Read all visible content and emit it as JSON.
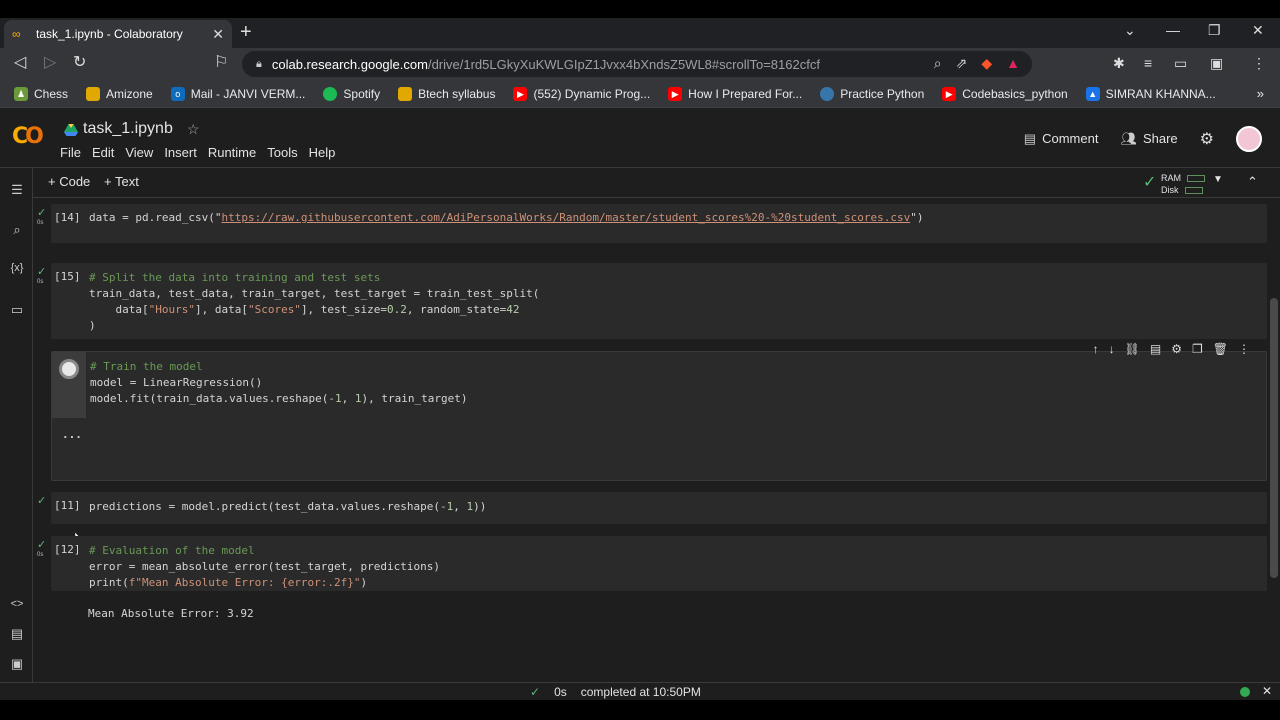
{
  "browser": {
    "tab_title": "task_1.ipynb - Colaboratory",
    "url_host": "colab.research.google.com",
    "url_path": "/drive/1rd5LGkyXuKWLGIpZ1Jvxx4bXndsZ5WL8#scrollTo=8162cfcf"
  },
  "bookmarks": [
    {
      "label": "Chess"
    },
    {
      "label": "Amizone"
    },
    {
      "label": "Mail - JANVI VERM..."
    },
    {
      "label": "Spotify"
    },
    {
      "label": "Btech syllabus"
    },
    {
      "label": "(552) Dynamic Prog..."
    },
    {
      "label": "How I Prepared For..."
    },
    {
      "label": "Practice Python"
    },
    {
      "label": "Codebasics_python"
    },
    {
      "label": "SIMRAN KHANNA..."
    }
  ],
  "colab": {
    "notebook_title": "task_1.ipynb",
    "menu": [
      "File",
      "Edit",
      "View",
      "Insert",
      "Runtime",
      "Tools",
      "Help"
    ],
    "comment_label": "Comment",
    "share_label": "Share",
    "add_code_label": "+ Code",
    "add_text_label": "+ Text",
    "ram_label": "RAM",
    "disk_label": "Disk"
  },
  "cells": [
    {
      "number": "[14]",
      "time": "0s",
      "code_line1_pre": "data = pd.read_csv(\"",
      "url": "https://raw.githubusercontent.com/AdiPersonalWorks/Random/master/student_scores%20-%20student_scores.csv",
      "code_line1_post": "\")"
    },
    {
      "number": "[15]",
      "time": "0s",
      "comment": "# Split the data into training and test sets",
      "line2": "train_data, test_data, train_target, test_target = train_test_split(",
      "line3_a": "    data[",
      "line3_s1": "\"Hours\"",
      "line3_b": "], data[",
      "line3_s2": "\"Scores\"",
      "line3_c": "], test_size=",
      "line3_n1": "0.2",
      "line3_d": ", random_state=",
      "line3_n2": "42",
      "line4": ")"
    },
    {
      "comment": "# Train the model",
      "line2": "model = LinearRegression()",
      "line3_a": "model.fit(train_data.values.reshape(",
      "line3_n1": "-1",
      "line3_b": ", ",
      "line3_n2": "1",
      "line3_c": "), train_target)",
      "output": "..."
    },
    {
      "number": "[11]",
      "line_a": "predictions = model.predict(test_data.values.reshape(",
      "n1": "-1",
      "line_b": ", ",
      "n2": "1",
      "line_c": "))"
    },
    {
      "number": "[12]",
      "time": "0s",
      "comment": "# Evaluation of the model",
      "line2": "error = mean_absolute_error(test_target, predictions)",
      "line3_a": "print(",
      "line3_s": "f\"Mean Absolute Error: {error:.2f}\"",
      "line3_b": ")",
      "output": "Mean Absolute Error: 3.92"
    }
  ],
  "status": {
    "duration": "0s",
    "text": "completed at 10:50PM"
  }
}
